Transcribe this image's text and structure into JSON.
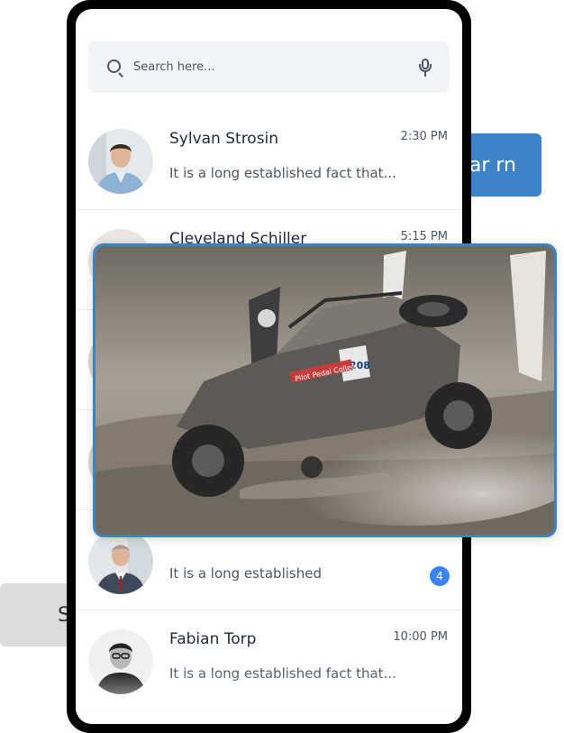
{
  "background": {
    "right_button_label": "ar rn",
    "left_button_label": "S"
  },
  "search": {
    "placeholder": "Search here...",
    "icon": "search-icon",
    "mic_icon": "mic-icon"
  },
  "conversations": [
    {
      "name": "Sylvan Strosin",
      "time": "2:30 PM",
      "message": "It is a long established fact that...",
      "badge": ""
    },
    {
      "name": "Cleveland Schiller",
      "time": "5:15 PM",
      "message": "",
      "badge": ""
    },
    {
      "name": "",
      "time": "",
      "message": "",
      "badge": ""
    },
    {
      "name": "",
      "time": "",
      "message": "",
      "badge": ""
    },
    {
      "name": "",
      "time": "",
      "message": "It is a long established",
      "badge": "4"
    },
    {
      "name": "Fabian Torp",
      "time": "10:00 PM",
      "message": "It is a long established fact that...",
      "badge": ""
    }
  ],
  "photo": {
    "icon": "image-photo",
    "car_number": "208",
    "sticker_text": "Pilot Pedal Collect"
  },
  "colors": {
    "accent": "#3b82c9",
    "badge": "#3b82f6",
    "phone_frame": "#000000"
  }
}
